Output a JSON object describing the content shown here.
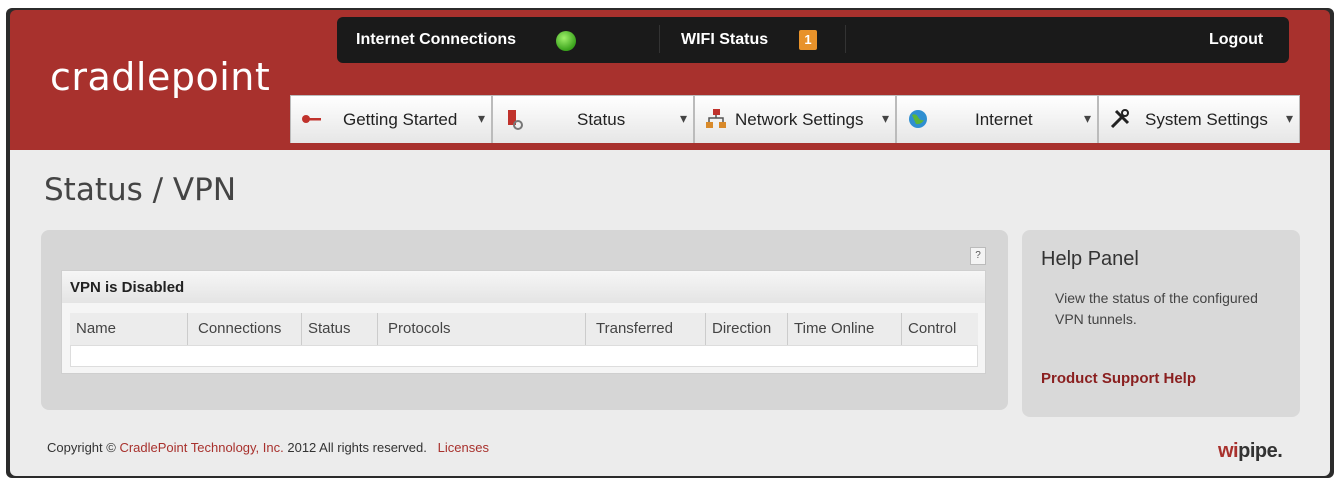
{
  "brand": {
    "logo_text": "cradlepoint"
  },
  "topbar": {
    "internet_connections": "Internet Connections",
    "wifi_status": "WIFI Status",
    "wifi_badge": "1",
    "logout": "Logout",
    "status_colors": {
      "internet": "#3aa31c",
      "wifi": "#e8922a"
    }
  },
  "nav": {
    "tabs": [
      {
        "label": "Getting Started",
        "icon": "key-icon"
      },
      {
        "label": "Status",
        "icon": "clipboard-icon"
      },
      {
        "label": "Network Settings",
        "icon": "network-icon"
      },
      {
        "label": "Internet",
        "icon": "globe-icon"
      },
      {
        "label": "System Settings",
        "icon": "tools-icon"
      }
    ],
    "caret": "▾"
  },
  "page": {
    "title": "Status / VPN"
  },
  "vpn": {
    "help_button": "?",
    "header": "VPN is Disabled",
    "columns": [
      "Name",
      "Connections",
      "Status",
      "Protocols",
      "Transferred",
      "Direction",
      "Time Online",
      "Control"
    ]
  },
  "help_panel": {
    "title": "Help Panel",
    "text": "View the status of the configured VPN tunnels.",
    "link": "Product Support Help"
  },
  "footer": {
    "prefix": "Copyright © ",
    "company": "CradlePoint Technology, Inc.",
    "suffix": " 2012 All rights reserved.",
    "licenses": "Licenses"
  },
  "wipipe": {
    "wi": "wi",
    "pipe": "pipe."
  },
  "colors": {
    "brand_red": "#a8312d",
    "link_red": "#8a1f1f"
  }
}
